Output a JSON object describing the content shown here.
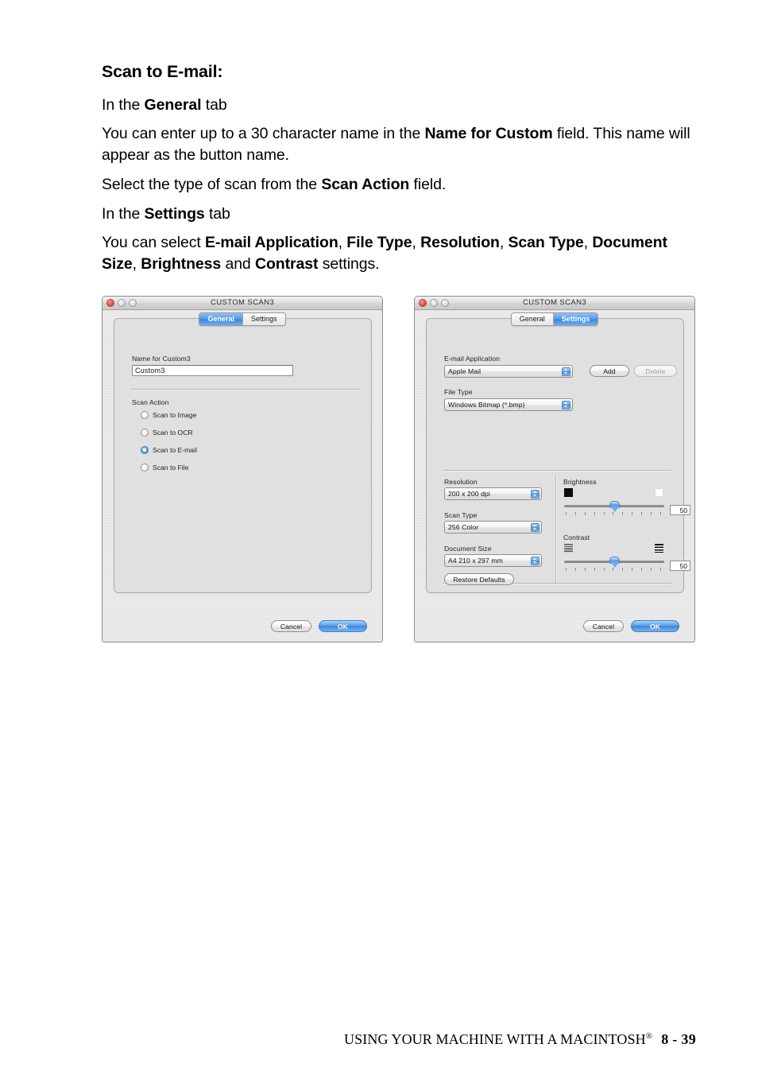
{
  "document": {
    "heading": "Scan to E-mail:",
    "paragraphs": [
      [
        {
          "t": "In the ",
          "b": false
        },
        {
          "t": "General",
          "b": true
        },
        {
          "t": " tab",
          "b": false
        }
      ],
      [
        {
          "t": "You can enter up to a 30 character name in the ",
          "b": false
        },
        {
          "t": "Name for Custom",
          "b": true
        },
        {
          "t": " field. This name will appear as the button name.",
          "b": false
        }
      ],
      [
        {
          "t": "Select the type of scan from the ",
          "b": false
        },
        {
          "t": "Scan Action",
          "b": true
        },
        {
          "t": " field.",
          "b": false
        }
      ],
      [
        {
          "t": "In the ",
          "b": false
        },
        {
          "t": "Settings",
          "b": true
        },
        {
          "t": " tab",
          "b": false
        }
      ],
      [
        {
          "t": "You can select ",
          "b": false
        },
        {
          "t": "E-mail Application",
          "b": true
        },
        {
          "t": ", ",
          "b": false
        },
        {
          "t": "File Type",
          "b": true
        },
        {
          "t": ", ",
          "b": false
        },
        {
          "t": "Resolution",
          "b": true
        },
        {
          "t": ", ",
          "b": false
        },
        {
          "t": "Scan Type",
          "b": true
        },
        {
          "t": ", ",
          "b": false
        },
        {
          "t": "Document Size",
          "b": true
        },
        {
          "t": ", ",
          "b": false
        },
        {
          "t": "Brightness",
          "b": true
        },
        {
          "t": " and ",
          "b": false
        },
        {
          "t": "Contrast",
          "b": true
        },
        {
          "t": " settings.",
          "b": false
        }
      ]
    ]
  },
  "dialog_general": {
    "title": "CUSTOM SCAN3",
    "tabs": [
      {
        "label": "General",
        "active": true
      },
      {
        "label": "Settings",
        "active": false
      }
    ],
    "name_label": "Name for Custom3",
    "name_value": "Custom3",
    "scan_action_label": "Scan Action",
    "scan_actions": [
      {
        "label": "Scan to Image",
        "selected": false
      },
      {
        "label": "Scan to OCR",
        "selected": false
      },
      {
        "label": "Scan to E-mail",
        "selected": true
      },
      {
        "label": "Scan to File",
        "selected": false
      }
    ],
    "cancel_label": "Cancel",
    "ok_label": "OK"
  },
  "dialog_settings": {
    "title": "CUSTOM SCAN3",
    "tabs": [
      {
        "label": "General",
        "active": false
      },
      {
        "label": "Settings",
        "active": true
      }
    ],
    "email_app_label": "E-mail Application",
    "email_app_value": "Apple Mail",
    "add_label": "Add",
    "delete_label": "Delete",
    "delete_disabled": true,
    "file_type_label": "File Type",
    "file_type_value": "Windows Bitmap (*.bmp)",
    "resolution_label": "Resolution",
    "resolution_value": "200 x 200 dpi",
    "scan_type_label": "Scan Type",
    "scan_type_value": "256 Color",
    "document_size_label": "Document Size",
    "document_size_value": "A4 210 x 297 mm",
    "brightness_label": "Brightness",
    "brightness_value": "50",
    "contrast_label": "Contrast",
    "contrast_value": "50",
    "restore_defaults_label": "Restore Defaults",
    "cancel_label": "Cancel",
    "ok_label": "OK"
  },
  "footer": {
    "text": "USING YOUR MACHINE WITH A MACINTOSH",
    "registered": "®",
    "page": "8 - 39"
  },
  "colors": {
    "aqua_blue": "#4d96e6",
    "window_gray": "#e3e3e3",
    "panel_gray": "#e0e0e0"
  }
}
